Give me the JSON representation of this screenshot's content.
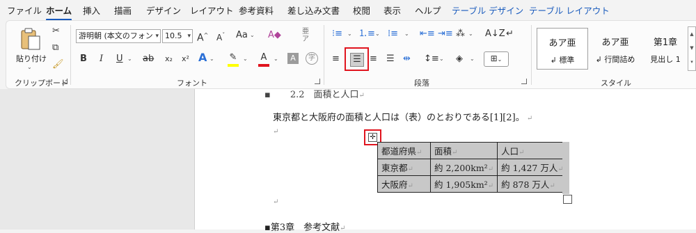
{
  "tabs": [
    "ファイル",
    "ホーム",
    "挿入",
    "描画",
    "デザイン",
    "レイアウト",
    "参考資料",
    "差し込み文書",
    "校閲",
    "表示",
    "ヘルプ",
    "テーブル デザイン",
    "テーブル レイアウト"
  ],
  "active_tab": "ホーム",
  "clipboard": {
    "paste_label": "貼り付け",
    "group_label": "クリップボード"
  },
  "font": {
    "font_name": "游明朝 (本文のフォン",
    "font_size": "10.5",
    "group_label": "フォント",
    "grow": "A",
    "shrink": "A",
    "case": "Aa",
    "bold": "B",
    "italic": "I",
    "underline": "U",
    "strike": "ab",
    "sub": "x₂",
    "sup": "x²",
    "color_a": "A",
    "shade_a": "A",
    "enclose": "字"
  },
  "paragraph": {
    "group_label": "段落"
  },
  "styles": {
    "group_label": "スタイル",
    "items": [
      {
        "sample": "あア亜",
        "name": "標準"
      },
      {
        "sample": "あア亜",
        "name": "行間詰め"
      },
      {
        "sample": "第1章",
        "name": "見出し 1"
      }
    ]
  },
  "document": {
    "heading_partial": "2.2　面積と人口",
    "body": "東京都と大阪府の面積と人口は（表）のとおりである[1][2]。",
    "table": {
      "headers": [
        "都道府県",
        "面積",
        "人口"
      ],
      "rows": [
        [
          "東京都",
          "約 2,200km²",
          "約 1,427 万人"
        ],
        [
          "大阪府",
          "約 1,905km²",
          "約 878 万人"
        ]
      ]
    },
    "next_heading": "第3章　参考文献"
  },
  "colors": {
    "accent": "#185abd",
    "highlight_box": "#e0141e",
    "table_selection": "#c8c8c8"
  }
}
